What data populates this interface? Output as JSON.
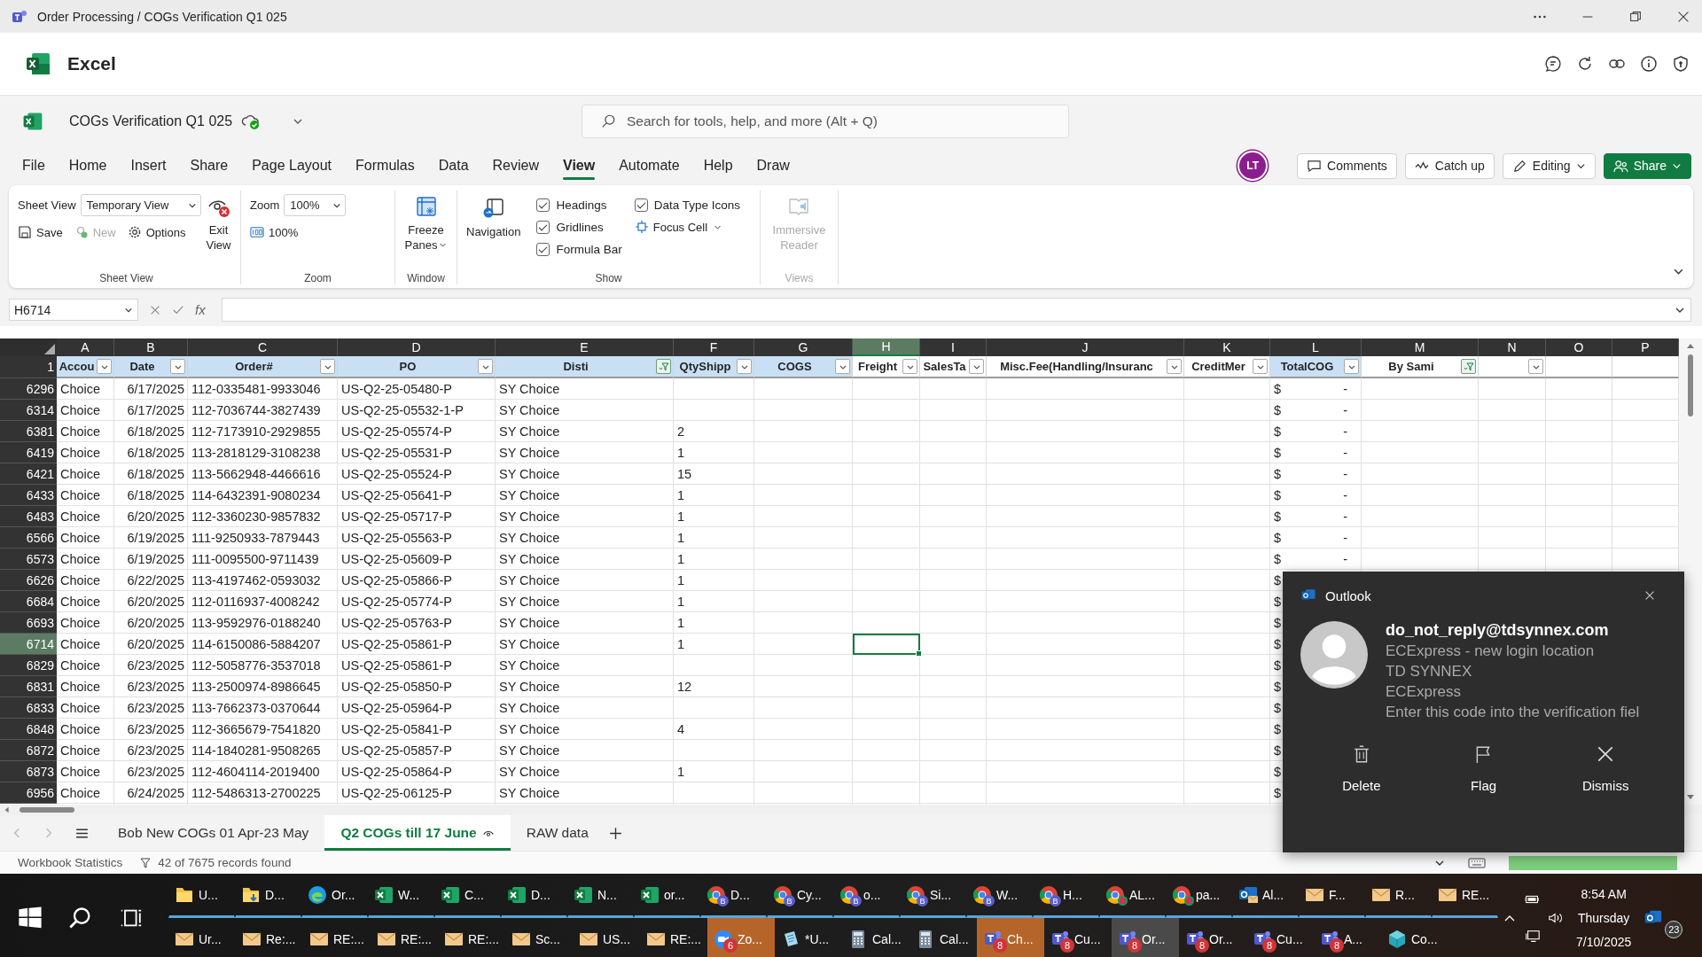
{
  "title_bar": {
    "title": "Order Processing / COGs Verification Q1 025"
  },
  "app_header": {
    "app_name": "Excel"
  },
  "document": {
    "name": "COGs Verification Q1 025",
    "search_placeholder": "Search for tools, help, and more (Alt + Q)"
  },
  "menu_tabs": [
    {
      "label": "File",
      "selected": false
    },
    {
      "label": "Home",
      "selected": false
    },
    {
      "label": "Insert",
      "selected": false
    },
    {
      "label": "Share",
      "selected": false
    },
    {
      "label": "Page Layout",
      "selected": false
    },
    {
      "label": "Formulas",
      "selected": false
    },
    {
      "label": "Data",
      "selected": false
    },
    {
      "label": "Review",
      "selected": false
    },
    {
      "label": "View",
      "selected": true
    },
    {
      "label": "Automate",
      "selected": false
    },
    {
      "label": "Help",
      "selected": false
    },
    {
      "label": "Draw",
      "selected": false
    }
  ],
  "user_avatar": "LT",
  "header_buttons": [
    {
      "label": "Comments",
      "kind": "comments"
    },
    {
      "label": "Catch up",
      "kind": "catchup"
    },
    {
      "label": "Editing",
      "kind": "editing"
    },
    {
      "label": "Share",
      "kind": "share"
    }
  ],
  "ribbon": {
    "sheet_view": {
      "title": "Sheet View",
      "field_label": "Sheet View",
      "view": "Temporary View",
      "actions": [
        {
          "label": "Save",
          "kind": "save",
          "disabled": false
        },
        {
          "label": "New",
          "kind": "new",
          "disabled": true
        },
        {
          "label": "Options",
          "kind": "options",
          "disabled": false
        }
      ],
      "exit_lines": [
        "Exit",
        "View"
      ]
    },
    "zoom": {
      "title": "Zoom",
      "field_label": "Zoom",
      "value": "100%",
      "reset_label": "100%"
    },
    "window": {
      "title": "Window",
      "freeze_lines": [
        "Freeze",
        "Panes"
      ]
    },
    "show": {
      "title": "Show",
      "navigation": "Navigation",
      "checkboxes": [
        {
          "label": "Headings",
          "checked": true
        },
        {
          "label": "Gridlines",
          "checked": true
        },
        {
          "label": "Formula Bar",
          "checked": true
        },
        {
          "label": "Data Type Icons",
          "checked": true
        }
      ],
      "focus_cell": "Focus Cell"
    },
    "views": {
      "title": "Views",
      "reader_lines": [
        "Immersive",
        "Reader"
      ],
      "disabled": true
    }
  },
  "formula_bar": {
    "name_box": "H6714",
    "function_label": "fx"
  },
  "columns": [
    {
      "letter": "A",
      "selected": false
    },
    {
      "letter": "B",
      "selected": false
    },
    {
      "letter": "C",
      "selected": false
    },
    {
      "letter": "D",
      "selected": false
    },
    {
      "letter": "E",
      "selected": false
    },
    {
      "letter": "F",
      "selected": false
    },
    {
      "letter": "G",
      "selected": false
    },
    {
      "letter": "H",
      "selected": true
    },
    {
      "letter": "I",
      "selected": false
    },
    {
      "letter": "J",
      "selected": false
    },
    {
      "letter": "K",
      "selected": false
    },
    {
      "letter": "L",
      "selected": false
    },
    {
      "letter": "M",
      "selected": false
    },
    {
      "letter": "N",
      "selected": false
    },
    {
      "letter": "O",
      "selected": false
    },
    {
      "letter": "P",
      "selected": false
    }
  ],
  "header_row": {
    "row": "1",
    "cells": [
      {
        "label": "Accou",
        "filter_button": true,
        "filtered": false,
        "in_table": true
      },
      {
        "label": "Date",
        "filter_button": true,
        "filtered": false,
        "in_table": true
      },
      {
        "label": "Order#",
        "filter_button": true,
        "filtered": false,
        "in_table": true
      },
      {
        "label": "PO",
        "filter_button": true,
        "filtered": false,
        "in_table": true
      },
      {
        "label": "Disti",
        "filter_button": true,
        "filtered": true,
        "in_table": true
      },
      {
        "label": "QtyShipp",
        "filter_button": true,
        "filtered": false,
        "in_table": true
      },
      {
        "label": "COGS",
        "filter_button": true,
        "filtered": false,
        "in_table": true
      },
      {
        "label": "Freight",
        "filter_button": true,
        "filtered": false,
        "in_table": false
      },
      {
        "label": "SalesTa",
        "filter_button": true,
        "filtered": false,
        "in_table": false
      },
      {
        "label": "Misc.Fee(Handling/Insuranc",
        "filter_button": true,
        "filtered": false,
        "in_table": false
      },
      {
        "label": "CreditMer",
        "filter_button": true,
        "filtered": false,
        "in_table": false
      },
      {
        "label": "TotalCOG",
        "filter_button": true,
        "filtered": false,
        "in_table": true
      },
      {
        "label": "By Sami",
        "filter_button": true,
        "filtered": true,
        "in_table": false
      },
      {
        "filter_button": true,
        "filtered": false,
        "in_table": false
      },
      {
        "in_table": false
      },
      {
        "in_table": false
      }
    ]
  },
  "rows": [
    {
      "row": "6296",
      "selected": false,
      "account": "Choice",
      "date": "6/17/2025",
      "order": "112-0335481-9933046",
      "po": "US-Q2-25-05480-P",
      "disti": "SY Choice",
      "currency": "$",
      "total": "-"
    },
    {
      "row": "6314",
      "selected": false,
      "account": "Choice",
      "date": "6/17/2025",
      "order": "112-7036744-3827439",
      "po": "US-Q2-25-05532-1-P",
      "disti": "SY Choice",
      "currency": "$",
      "total": "-"
    },
    {
      "row": "6381",
      "selected": false,
      "account": "Choice",
      "date": "6/18/2025",
      "order": "112-7173910-2929855",
      "po": "US-Q2-25-05574-P",
      "disti": "SY Choice",
      "qty": "2",
      "currency": "$",
      "total": "-"
    },
    {
      "row": "6419",
      "selected": false,
      "account": "Choice",
      "date": "6/18/2025",
      "order": "113-2818129-3108238",
      "po": "US-Q2-25-05531-P",
      "disti": "SY Choice",
      "qty": "1",
      "currency": "$",
      "total": "-"
    },
    {
      "row": "6421",
      "selected": false,
      "account": "Choice",
      "date": "6/18/2025",
      "order": "113-5662948-4466616",
      "po": "US-Q2-25-05524-P",
      "disti": "SY Choice",
      "qty": "15",
      "currency": "$",
      "total": "-"
    },
    {
      "row": "6433",
      "selected": false,
      "account": "Choice",
      "date": "6/18/2025",
      "order": "114-6432391-9080234",
      "po": "US-Q2-25-05641-P",
      "disti": "SY Choice",
      "qty": "1",
      "currency": "$",
      "total": "-"
    },
    {
      "row": "6483",
      "selected": false,
      "account": "Choice",
      "date": "6/20/2025",
      "order": "112-3360230-9857832",
      "po": "US-Q2-25-05717-P",
      "disti": "SY Choice",
      "qty": "1",
      "currency": "$",
      "total": "-"
    },
    {
      "row": "6566",
      "selected": false,
      "account": "Choice",
      "date": "6/19/2025",
      "order": "111-9250933-7879443",
      "po": "US-Q2-25-05563-P",
      "disti": "SY Choice",
      "qty": "1",
      "currency": "$",
      "total": "-"
    },
    {
      "row": "6573",
      "selected": false,
      "account": "Choice",
      "date": "6/19/2025",
      "order": "111-0095500-9711439",
      "po": "US-Q2-25-05609-P",
      "disti": "SY Choice",
      "qty": "1",
      "currency": "$",
      "total": "-"
    },
    {
      "row": "6626",
      "selected": false,
      "account": "Choice",
      "date": "6/22/2025",
      "order": "113-4197462-0593032",
      "po": "US-Q2-25-05866-P",
      "disti": "SY Choice",
      "qty": "1",
      "currency": "$"
    },
    {
      "row": "6684",
      "selected": false,
      "account": "Choice",
      "date": "6/20/2025",
      "order": "112-0116937-4008242",
      "po": "US-Q2-25-05774-P",
      "disti": "SY Choice",
      "qty": "1",
      "currency": "$"
    },
    {
      "row": "6693",
      "selected": false,
      "account": "Choice",
      "date": "6/20/2025",
      "order": "113-9592976-0188240",
      "po": "US-Q2-25-05763-P",
      "disti": "SY Choice",
      "qty": "1",
      "currency": "$"
    },
    {
      "row": "6714",
      "selected": true,
      "account": "Choice",
      "date": "6/20/2025",
      "order": "114-6150086-5884207",
      "po": "US-Q2-25-05861-P",
      "disti": "SY Choice",
      "qty": "1",
      "currency": "$"
    },
    {
      "row": "6829",
      "selected": false,
      "account": "Choice",
      "date": "6/23/2025",
      "order": "112-5058776-3537018",
      "po": "US-Q2-25-05861-P",
      "disti": "SY Choice",
      "currency": "$"
    },
    {
      "row": "6831",
      "selected": false,
      "account": "Choice",
      "date": "6/23/2025",
      "order": "113-2500974-8986645",
      "po": "US-Q2-25-05850-P",
      "disti": "SY Choice",
      "qty": "12",
      "currency": "$"
    },
    {
      "row": "6833",
      "selected": false,
      "account": "Choice",
      "date": "6/23/2025",
      "order": "113-7662373-0370644",
      "po": "US-Q2-25-05964-P",
      "disti": "SY Choice",
      "currency": "$"
    },
    {
      "row": "6848",
      "selected": false,
      "account": "Choice",
      "date": "6/23/2025",
      "order": "112-3665679-7541820",
      "po": "US-Q2-25-05841-P",
      "disti": "SY Choice",
      "qty": "4",
      "currency": "$"
    },
    {
      "row": "6872",
      "selected": false,
      "account": "Choice",
      "date": "6/23/2025",
      "order": "114-1840281-9508265",
      "po": "US-Q2-25-05857-P",
      "disti": "SY Choice",
      "currency": "$"
    },
    {
      "row": "6873",
      "selected": false,
      "account": "Choice",
      "date": "6/23/2025",
      "order": "112-4604114-2019400",
      "po": "US-Q2-25-05864-P",
      "disti": "SY Choice",
      "qty": "1",
      "currency": "$"
    },
    {
      "row": "6956",
      "selected": false,
      "account": "Choice",
      "date": "6/24/2025",
      "order": "112-5486313-2700225",
      "po": "US-Q2-25-06125-P",
      "disti": "SY Choice",
      "currency": "$"
    }
  ],
  "sheet_tabs": [
    {
      "label": "Bob New COGs 01 Apr-23 May",
      "selected": false,
      "watched": false
    },
    {
      "label": "Q2 COGs till 17 June",
      "selected": true,
      "watched": true
    },
    {
      "label": "RAW data",
      "selected": false,
      "watched": false
    }
  ],
  "status_bar": {
    "statistics": "Workbook Statistics",
    "filter_status": "42 of 7675 records found"
  },
  "taskbar": {
    "row_1": [
      {
        "label": "U...",
        "kind": "folder",
        "alert": false,
        "attention": false,
        "selected": false
      },
      {
        "label": "D...",
        "kind": "folderdown",
        "alert": false,
        "attention": false,
        "selected": false
      },
      {
        "label": "Or...",
        "kind": "edge",
        "alert": false,
        "attention": false,
        "selected": false
      },
      {
        "label": "W...",
        "kind": "excel",
        "alert": false,
        "attention": false,
        "selected": false
      },
      {
        "label": "C...",
        "kind": "excel",
        "alert": false,
        "attention": false,
        "selected": false
      },
      {
        "label": "D...",
        "kind": "excel",
        "alert": false,
        "attention": false,
        "selected": false
      },
      {
        "label": "N...",
        "kind": "excel",
        "alert": false,
        "attention": false,
        "selected": false
      },
      {
        "label": "or...",
        "kind": "excel",
        "alert": false,
        "attention": false,
        "selected": false
      },
      {
        "label": "D...",
        "kind": "chrome",
        "profile": "B",
        "alert": false,
        "attention": false,
        "selected": false
      },
      {
        "label": "Cy...",
        "kind": "chrome",
        "profile": "B",
        "alert": false,
        "attention": false,
        "selected": false
      },
      {
        "label": "o...",
        "kind": "chrome",
        "profile": "B",
        "alert": false,
        "attention": false,
        "selected": false
      },
      {
        "label": "Si...",
        "kind": "chrome",
        "profile": "B",
        "alert": false,
        "attention": false,
        "selected": false
      },
      {
        "label": "W...",
        "kind": "chrome",
        "profile": "B",
        "alert": false,
        "attention": false,
        "selected": false
      },
      {
        "label": "H...",
        "kind": "chrome",
        "profile": "B",
        "alert": false,
        "attention": false,
        "selected": false
      },
      {
        "label": "AL...",
        "kind": "chrome",
        "alert": true,
        "attention": false,
        "selected": false
      },
      {
        "label": "pa...",
        "kind": "chrome",
        "alert": true,
        "attention": false,
        "selected": false
      },
      {
        "label": "Al...",
        "kind": "outlook",
        "alert": false,
        "attention": false,
        "selected": false
      },
      {
        "label": "F...",
        "kind": "mail",
        "alert": false,
        "attention": false,
        "selected": false
      },
      {
        "label": "R...",
        "kind": "mail",
        "alert": false,
        "attention": false,
        "selected": false
      },
      {
        "label": "RE...",
        "kind": "mail",
        "alert": false,
        "attention": false,
        "selected": false
      }
    ],
    "row_2": [
      {
        "label": "Ur...",
        "kind": "mail",
        "alert": false,
        "attention": false,
        "selected": false
      },
      {
        "label": "Re:...",
        "kind": "mail",
        "alert": false,
        "attention": false,
        "selected": false
      },
      {
        "label": "RE:...",
        "kind": "mail",
        "alert": false,
        "attention": false,
        "selected": false
      },
      {
        "label": "RE:...",
        "kind": "mail",
        "alert": false,
        "attention": false,
        "selected": false
      },
      {
        "label": "RE:...",
        "kind": "mail",
        "alert": false,
        "attention": false,
        "selected": false
      },
      {
        "label": "Sc...",
        "kind": "mail",
        "alert": false,
        "attention": false,
        "selected": false
      },
      {
        "label": "US...",
        "kind": "mail",
        "alert": false,
        "attention": false,
        "selected": false
      },
      {
        "label": "RE:...",
        "kind": "mail",
        "alert": false,
        "attention": false,
        "selected": false
      },
      {
        "label": "Zo...",
        "kind": "zoom",
        "badge": "6",
        "alert": false,
        "attention": true,
        "selected": false
      },
      {
        "label": "*U...",
        "kind": "notepad",
        "alert": false,
        "attention": false,
        "selected": false
      },
      {
        "label": "Cal...",
        "kind": "calculator",
        "alert": false,
        "attention": false,
        "selected": false
      },
      {
        "label": "Cal...",
        "kind": "calculator",
        "alert": false,
        "attention": false,
        "selected": false
      },
      {
        "label": "Ch...",
        "kind": "teams",
        "badge": "8",
        "alert": false,
        "attention": true,
        "selected": false
      },
      {
        "label": "Cu...",
        "kind": "teams",
        "badge": "8",
        "alert": false,
        "attention": false,
        "selected": false
      },
      {
        "label": "Or...",
        "kind": "teams",
        "badge": "8",
        "alert": false,
        "attention": false,
        "selected": true
      },
      {
        "label": "Or...",
        "kind": "teams",
        "badge": "8",
        "alert": false,
        "attention": false,
        "selected": false
      },
      {
        "label": "Cu...",
        "kind": "teams",
        "badge": "8",
        "alert": false,
        "attention": false,
        "selected": false
      },
      {
        "label": "A...",
        "kind": "teams",
        "badge": "8",
        "alert": false,
        "attention": false,
        "selected": false
      },
      {
        "label": "Co...",
        "kind": "cube",
        "alert": false,
        "attention": false,
        "selected": false
      }
    ],
    "clock": {
      "time": "8:54 AM",
      "day": "Thursday",
      "date": "7/10/2025"
    },
    "notification_count": "23"
  },
  "notification": {
    "app": "Outlook",
    "sender": "do_not_reply@tdsynnex.com",
    "lines": [
      "ECExpress - new login location",
      "TD SYNNEX",
      "ECExpress",
      "Enter this code into the verification fiel"
    ],
    "actions": [
      {
        "label": "Delete",
        "kind": "delete"
      },
      {
        "label": "Flag",
        "kind": "flag"
      },
      {
        "label": "Dismiss",
        "kind": "dismiss"
      }
    ]
  }
}
